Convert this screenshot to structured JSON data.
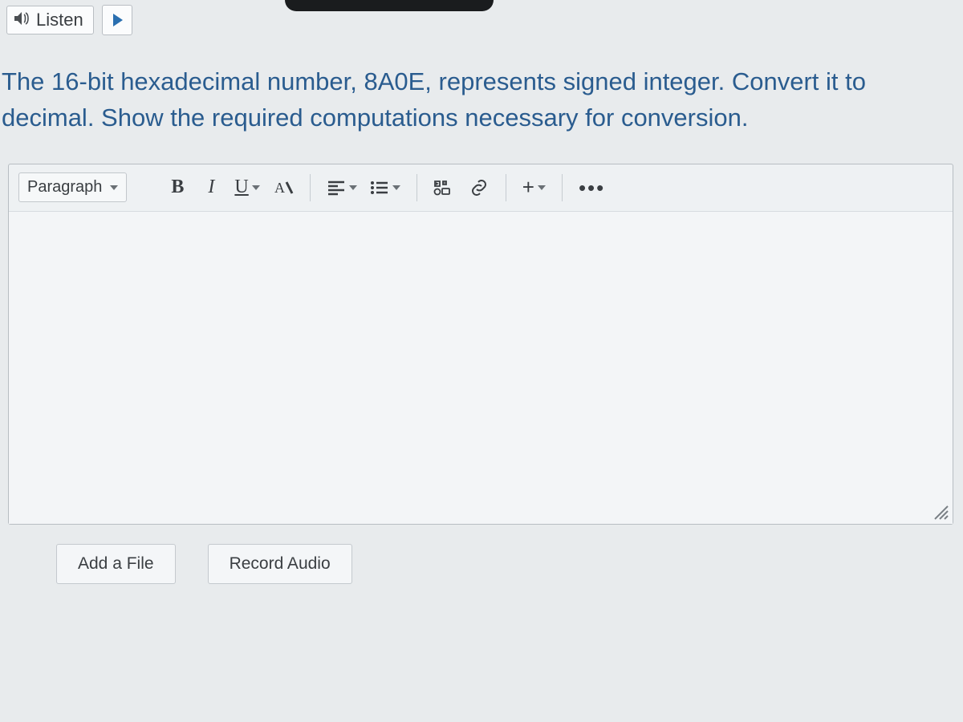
{
  "top": {
    "listen_label": "Listen"
  },
  "question_text": "The 16-bit hexadecimal number, 8A0E,  represents signed integer. Convert it to decimal. Show the required computations necessary for conversion.",
  "toolbar": {
    "format_select": "Paragraph",
    "bold": "B",
    "italic": "I",
    "underline": "U",
    "plus": "+"
  },
  "actions": {
    "add_file": "Add a File",
    "record_audio": "Record Audio"
  }
}
